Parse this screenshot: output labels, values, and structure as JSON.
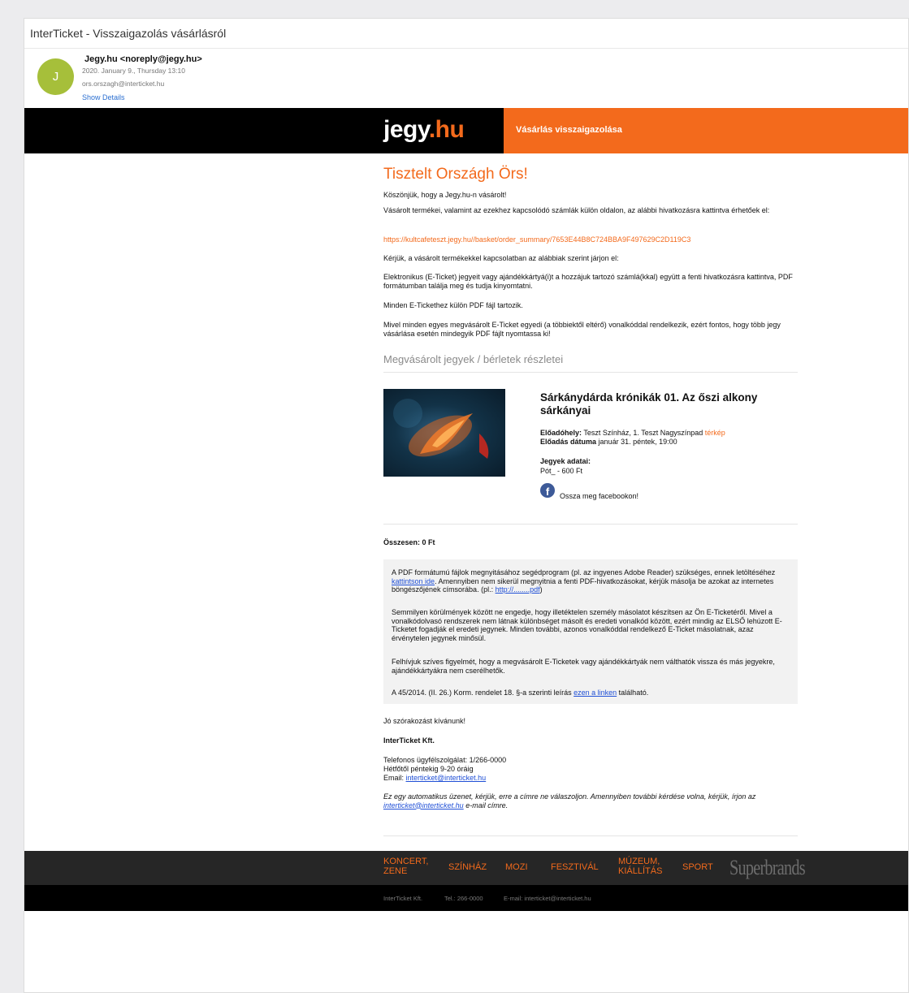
{
  "window": {
    "subject": "InterTicket - Visszaigazolás vásárlásról"
  },
  "message": {
    "avatar_letter": "J",
    "sender": "Jegy.hu <noreply@jegy.hu>",
    "date": "2020. January 9., Thursday 13:10",
    "recipient": "ors.orszagh@interticket.hu",
    "show_details": "Show Details"
  },
  "banner": {
    "logo_main": "jegy",
    "logo_suffix": ".hu",
    "title": "Vásárlás visszaigazolása"
  },
  "body": {
    "greeting": "Tisztelt Országh Örs!",
    "p1": "Köszönjük, hogy a Jegy.hu-n vásárolt!",
    "p2": "Vásárolt termékei, valamint az ezekhez kapcsolódó számlák külön oldalon, az alábbi hivatkozásra kattintva érhetőek el:",
    "order_link": "https://kultcafeteszt.jegy.hu//basket/order_summary/7653E44B8C724BBA9F497629C2D119C3",
    "p3": "Kérjük, a vásárolt termékekkel kapcsolatban az alábbiak szerint járjon el:",
    "p4": "Elektronikus (E-Ticket) jegyeit vagy ajándékkártyá(i)t a hozzájuk tartozó számlá(kkal) együtt a fenti hivatkozásra kattintva, PDF formátumban találja meg és tudja kinyomtatni.",
    "p5": "Minden E-Tickethez külön PDF fájl tartozik.",
    "p6": "Mivel minden egyes megvásárolt E-Ticket egyedi (a többiektől eltérő) vonalkóddal rendelkezik, ezért fontos, hogy több jegy vásárlása esetén mindegyik PDF fájlt nyomtassa ki!",
    "section_title": "Megvásárolt jegyek / bérletek részletei"
  },
  "ticket": {
    "event_title": "Sárkánydárda krónikák 01. Az őszi alkony sárkányai",
    "venue_label": "Előadóhely:",
    "venue_value": "Teszt Színház, 1. Teszt Nagyszínpad",
    "map_link": "térkép",
    "date_label": "Előadás dátuma",
    "date_value": "január 31. péntek, 19:00",
    "tickets_heading": "Jegyek adatai:",
    "ticket_item": "Pót_ - 600 Ft",
    "share_label": "Ossza meg facebookon!"
  },
  "total": "Összesen: 0 Ft",
  "note": {
    "n1_a": "A PDF formátumú fájlok megnyitásához segédprogram (pl. az ingyenes Adobe Reader) szükséges, ennek letöltéséhez ",
    "n1_link1": "kattintson ide",
    "n1_b": ". Amennyiben nem sikerül megnyitnia a fenti PDF-hivatkozásokat, kérjük másolja be azokat az internetes böngészőjének címsorába. (pl.: ",
    "n1_link2": "http://........pdf",
    "n1_c": ")",
    "n2": "Semmilyen körülmények között ne engedje, hogy illetéktelen személy másolatot készítsen az Ön E-Ticketéről. Mivel a vonalkódolvasó rendszerek nem látnak különbséget másolt és eredeti vonalkód között, ezért mindig az ELSŐ lehúzott E-Ticketet fogadják el eredeti jegynek. Minden további, azonos vonalkóddal rendelkező E-Ticket másolatnak, azaz érvénytelen jegynek minősül.",
    "n3": "Felhívjuk szíves figyelmét, hogy a megvásárolt E-Ticketek vagy ajándékkártyák nem válthatók vissza és más jegyekre, ajándékkártyákra nem cserélhetők.",
    "n4_a": "A 45/2014. (II. 26.) Korm. rendelet 18. §-a szerinti leírás ",
    "n4_link": "ezen a linken",
    "n4_b": " található."
  },
  "closing": {
    "wish": "Jó szórakozást kívánunk!",
    "company": "InterTicket Kft.",
    "phone": "Telefonos ügyfélszolgálat: 1/266-0000",
    "hours": "Hétfőtől péntekig 9-20 óráig",
    "email_label": "Email: ",
    "email": "interticket@interticket.hu",
    "auto_a": "Ez egy automatikus üzenet, kérjük, erre a címre ne válaszoljon. Amennyiben további kérdése volna, kérjük, írjon az ",
    "auto_link": "interticket@interticket.hu",
    "auto_b": " e-mail címre."
  },
  "footer": {
    "nav_1a": "Koncert,",
    "nav_1b": "zene",
    "nav_2": "Színház",
    "nav_3": "Mozi",
    "nav_4": "Fesztivál",
    "nav_5a": "Múzeum,",
    "nav_5b": "kiállítás",
    "nav_6": "Sport",
    "superbrands": "Superbrands",
    "company": "InterTicket Kft.",
    "tel": "Tel.: 266-0000",
    "email": "E-mail: interticket@interticket.hu"
  },
  "colors": {
    "brand": "#f36a1c",
    "avatar": "#a6bf3a",
    "link": "#1f4fd6",
    "facebook": "#3d5a98"
  },
  "icons": {
    "share": "facebook-icon"
  }
}
